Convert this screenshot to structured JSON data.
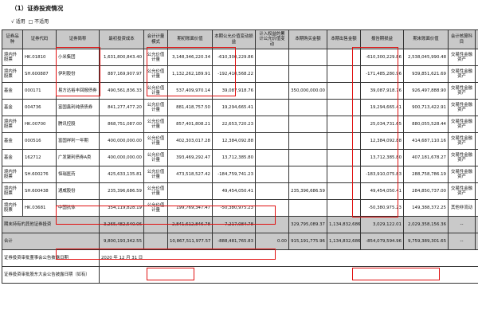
{
  "section_title": "（1）证券投资情况",
  "scope_option": {
    "applicable": "√ 适用",
    "not_applicable": "□ 不适用"
  },
  "headers": [
    "证券品种",
    "证券代码",
    "证券简称",
    "最初投资成本",
    "会计计量模式",
    "期初账面价值",
    "本期公允价值变动损益",
    "计入权益的累计公允价值变动",
    "本期购买金额",
    "本期出售金额",
    "报告期损益",
    "期末账面价值",
    "会计核算科目",
    "资金来源"
  ],
  "rows": [
    [
      "境内外股票",
      "HK.01810",
      "小米集团",
      "1,631,800,843.40",
      "公允价值计量",
      "3,148,346,220.34",
      "-610,300,229.86",
      "",
      "",
      "",
      "-610,300,229.86",
      "2,538,045,990.48",
      "交易性金融资产",
      "自有"
    ],
    [
      "境内外股票",
      "SH.600887",
      "伊利股份",
      "887,169,907.97",
      "公允价值计量",
      "1,132,262,189.91",
      "-192,410,568.22",
      "",
      "",
      "",
      "-171,485,280.96",
      "939,851,621.69",
      "交易性金融资产",
      "自有"
    ],
    [
      "基金",
      "000171",
      "易方达裕丰回报债券",
      "490,561,836.33",
      "公允价值计量",
      "537,409,970.14",
      "39,087,918.76",
      "",
      "350,000,000.00",
      "",
      "39,087,918.76",
      "926,497,888.90",
      "交易性金融资产",
      "自有"
    ],
    [
      "基金",
      "004736",
      "富国鑫利纯债债券",
      "841,277,477.20",
      "公允价值计量",
      "881,418,757.50",
      "19,294,665.41",
      "",
      "",
      "",
      "19,294,665.41",
      "900,713,422.91",
      "交易性金融资产",
      "自有"
    ],
    [
      "境内外股票",
      "HK.00700",
      "腾讯控股",
      "868,751,087.00",
      "公允价值计量",
      "857,401,808.21",
      "22,653,720.23",
      "",
      "",
      "",
      "25,034,731.65",
      "880,055,528.44",
      "交易性金融资产",
      "自有"
    ],
    [
      "基金",
      "000516",
      "富国祥利一年期",
      "400,000,000.00",
      "公允价值计量",
      "402,303,017.28",
      "12,384,092.88",
      "",
      "",
      "",
      "12,384,092.88",
      "414,687,110.16",
      "交易性金融资产",
      "自有"
    ],
    [
      "基金",
      "162712",
      "广发聚利债券A类",
      "400,000,000.00",
      "公允价值计量",
      "393,469,292.47",
      "13,712,385.80",
      "",
      "",
      "",
      "13,712,385.80",
      "407,181,678.27",
      "交易性金融资产",
      "自有"
    ],
    [
      "境内外股票",
      "SH.600276",
      "恒瑞医药",
      "425,633,135.81",
      "公允价值计量",
      "473,518,527.42",
      "-184,759,741.23",
      "",
      "",
      "",
      "-183,910,075.83",
      "288,758,786.19",
      "交易性金融资产",
      "自有"
    ],
    [
      "境内外股票",
      "SH.600438",
      "通威股份",
      "235,396,686.59",
      "公允价值计量",
      "",
      "49,454,050.41",
      "",
      "235,396,686.59",
      "",
      "49,454,050.41",
      "284,850,737.00",
      "交易性金融资产",
      "自有"
    ],
    [
      "境内外股票",
      "HK.03681",
      "中国抗体",
      "354,119,828.19",
      "公允价值计量",
      "199,769,347.47",
      "-50,380,975.23",
      "",
      "",
      "",
      "-50,380,975.23",
      "149,388,372.25",
      "其他非流动",
      "自有"
    ]
  ],
  "other_row": {
    "label": "期末持有的其他证券投资",
    "initial_cost": "3,265,482,540.06",
    "opening_value": "2,841,612,846.78",
    "fv_change": "-7,217,084.78",
    "purchase": "329,795,089.37",
    "sale": "1,134,832,686.00",
    "pl": "3,029,122.01",
    "ending_value": "2,029,358,156.36",
    "account": "--",
    "source": "--"
  },
  "total_row": {
    "label": "合计",
    "initial_cost": "9,800,193,342.55",
    "opening_value": "10,867,511,977.57",
    "fv_change": "-888,481,765.83",
    "cum_fv": "0.00",
    "purchase": "915,191,775.96",
    "sale": "1,134,832,686.00",
    "pl": "-854,079,594.96",
    "ending_value": "9,759,389,301.65",
    "account": "--",
    "source": "--"
  },
  "footer": {
    "board_label": "证券投资审批董事会公告披露日期",
    "board_value": "2020 年 12 月 31 日",
    "holders_label": "证券投资审批股东大会公告披露日期（如有）",
    "holders_value": ""
  }
}
